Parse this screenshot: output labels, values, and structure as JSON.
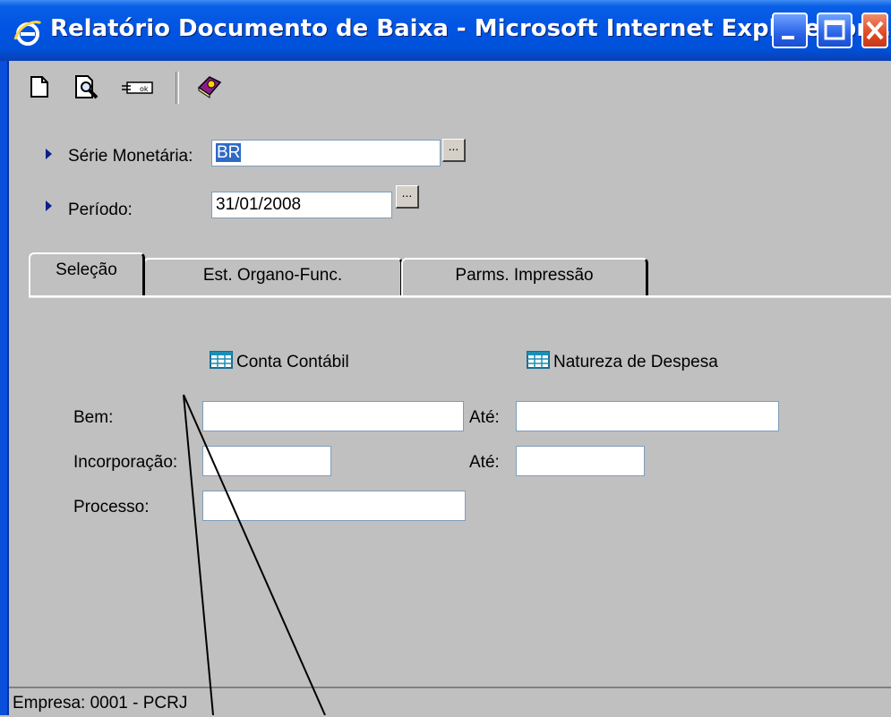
{
  "window": {
    "title": "Relatório Documento de Baixa - Microsoft Internet Explorer pr...",
    "controls": [
      "minimize",
      "maximize",
      "close"
    ]
  },
  "toolbar": {
    "icons": [
      "new-document-icon",
      "print-preview-icon",
      "report-icon",
      "help-book-icon"
    ]
  },
  "form": {
    "serie_label": "Série Monetária:",
    "serie_value": "BR",
    "periodo_label": "Período:",
    "periodo_value": "31/01/2008",
    "ellipsis": "..."
  },
  "tabs": [
    {
      "label": "Seleção",
      "active": true
    },
    {
      "label": "Est. Organo-Func.",
      "active": false
    },
    {
      "label": "Parms. Impressão",
      "active": false
    }
  ],
  "selection": {
    "conta_contabil": "Conta Contábil",
    "natureza_despesa": "Natureza de Despesa",
    "bem_label": "Bem:",
    "bem_value": "",
    "bem_ate_label": "Até:",
    "bem_ate_value": "",
    "incorporacao_label": "Incorporação:",
    "incorporacao_value": "",
    "incorporacao_ate_label": "Até:",
    "incorporacao_ate_value": "",
    "processo_label": "Processo:",
    "processo_value": ""
  },
  "status": {
    "text": "Empresa: 0001 - PCRJ"
  },
  "colors": {
    "titlebar": "#0054e3",
    "selection_highlight": "#316ac5",
    "window_face": "#c0c0c0"
  }
}
